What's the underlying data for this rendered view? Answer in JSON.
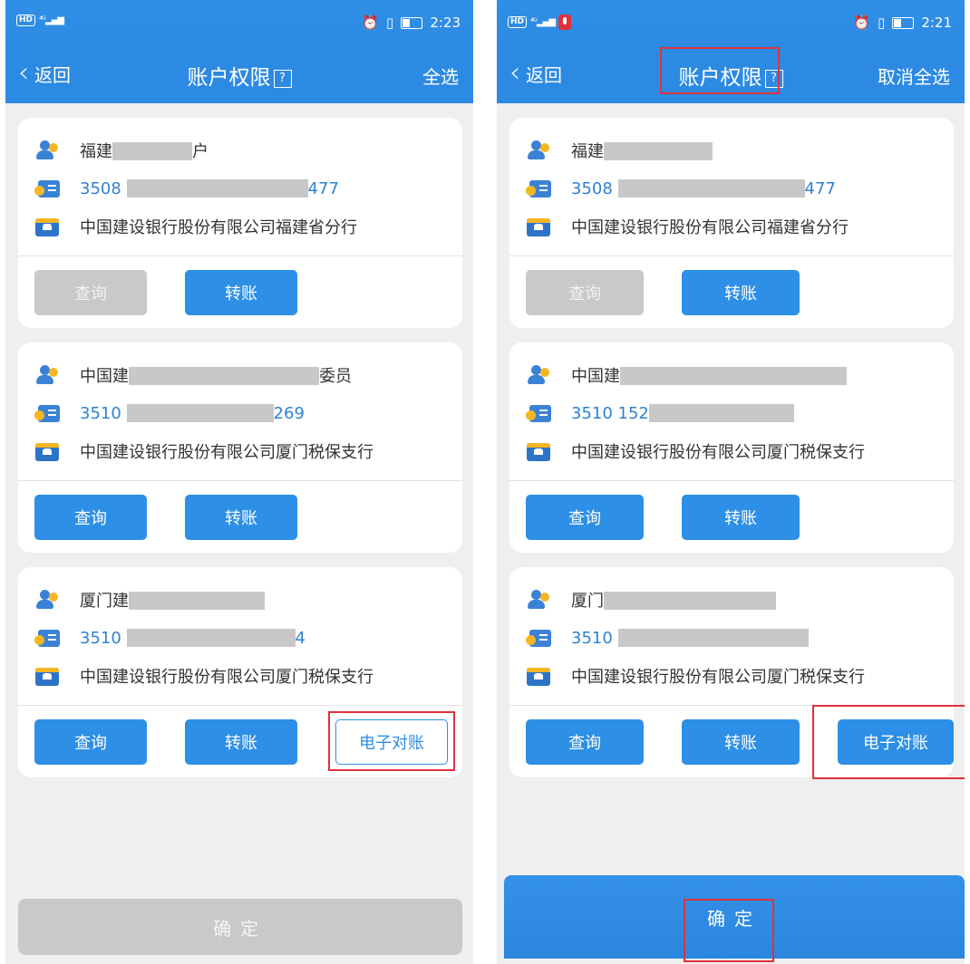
{
  "left": {
    "status": {
      "hd": "HD",
      "signal": "4G",
      "time": "2:23"
    },
    "nav": {
      "back": "返回",
      "title": "账户权限",
      "help": "?",
      "right": "全选"
    },
    "cards": [
      {
        "name_a": "福建",
        "name_b": "户",
        "acct_a": "3508",
        "acct_b": "477",
        "bank": "中国建设银行股份有限公司福建省分行",
        "btns": [
          "查询",
          "转账"
        ]
      },
      {
        "name_a": "中国建",
        "name_b": "委员",
        "acct_a": "3510",
        "acct_b": "269",
        "bank": "中国建设银行股份有限公司厦门税保支行",
        "btns": [
          "查询",
          "转账"
        ]
      },
      {
        "name_a": "厦门建",
        "name_b": "",
        "acct_a": "3510",
        "acct_b": "4",
        "bank": "中国建设银行股份有限公司厦门税保支行",
        "btns": [
          "查询",
          "转账",
          "电子对账"
        ]
      }
    ],
    "confirm": "确定"
  },
  "right": {
    "status": {
      "hd": "HD",
      "signal": "4G",
      "time": "2:21"
    },
    "nav": {
      "back": "返回",
      "title": "账户权限",
      "help": "?",
      "right": "取消全选"
    },
    "cards": [
      {
        "name_a": "福建",
        "name_b": "",
        "acct_a": "3508",
        "acct_b": "477",
        "bank": "中国建设银行股份有限公司福建省分行",
        "btns": [
          "查询",
          "转账"
        ]
      },
      {
        "name_a": "中国建",
        "name_b": "",
        "acct_a": "3510 152",
        "acct_b": "",
        "bank": "中国建设银行股份有限公司厦门税保支行",
        "btns": [
          "查询",
          "转账"
        ]
      },
      {
        "name_a": "厦门",
        "name_b": "",
        "acct_a": "3510",
        "acct_b": "",
        "bank": "中国建设银行股份有限公司厦门税保支行",
        "btns": [
          "查询",
          "转账",
          "电子对账"
        ]
      }
    ],
    "confirm": "确定"
  },
  "colors": {
    "primary": "#2d8ae3",
    "highlight": "#e0323b",
    "disabled": "#c9c9c9",
    "account_text": "#2f82d3"
  },
  "icons": [
    "person-icon",
    "id-card-icon",
    "bank-icon",
    "back-chevron-icon",
    "help-icon",
    "alarm-icon",
    "vibrate-icon",
    "battery-icon",
    "signal-icon",
    "mic-icon"
  ]
}
